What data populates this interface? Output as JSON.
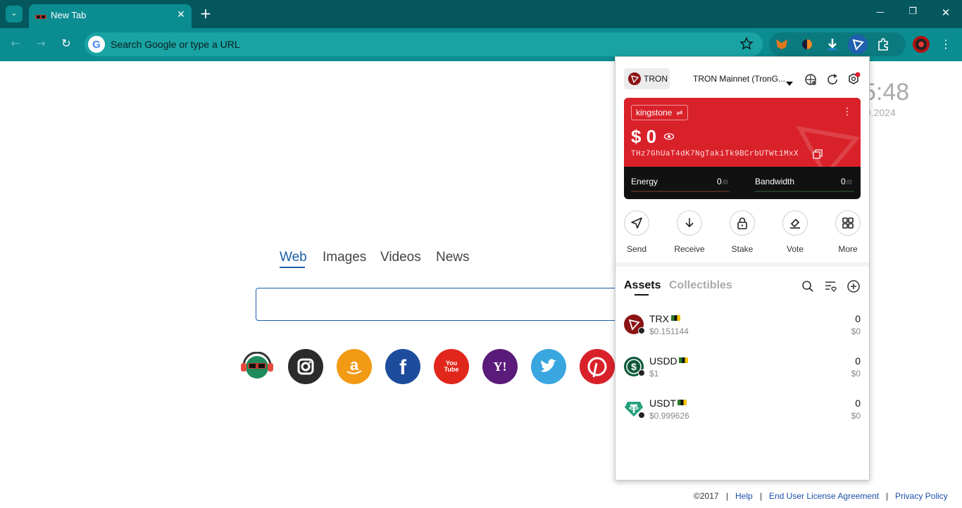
{
  "browser": {
    "tab_title": "New Tab",
    "omnibox_placeholder": "Search Google or type a URL",
    "tab_close_glyph": "✕",
    "new_tab_glyph": "+",
    "minimize_glyph": "—",
    "restore_glyph": "❐",
    "close_glyph": "✕"
  },
  "page": {
    "search_tabs": [
      "Web",
      "Images",
      "Videos",
      "News"
    ],
    "active_tab": "Web",
    "clock_time": "5:48",
    "clock_date": ".9.2024",
    "footer": {
      "copyright": "©2017",
      "sep": "|",
      "help": "Help",
      "eula": "End User License Agreement",
      "privacy": "Privacy Policy"
    },
    "social_icons": [
      {
        "name": "instagram",
        "color": "#2b2b2b"
      },
      {
        "name": "amazon",
        "color": "#f29a13"
      },
      {
        "name": "facebook",
        "color": "#1d4c9c"
      },
      {
        "name": "youtube",
        "color": "#e1261c"
      },
      {
        "name": "yahoo",
        "color": "#5b1b7a"
      },
      {
        "name": "twitter",
        "color": "#3aa6e0"
      },
      {
        "name": "pinterest",
        "color": "#d9212a"
      }
    ],
    "youtube_label": "You Tube",
    "yahoo_label": "Y!"
  },
  "wallet": {
    "network_chip": "TRON",
    "network_select": "TRON Mainnet (TronG...",
    "account": {
      "name": "kingstone",
      "switch_glyph": "⇌",
      "balance": "$ 0",
      "address": "THz7GhUaT4dK7NgTakiTk9BCrbUTWt1MxX"
    },
    "resources": {
      "energy_label": "Energy",
      "energy_value": "0",
      "energy_max": "/0",
      "bandwidth_label": "Bandwidth",
      "bandwidth_value": "0",
      "bandwidth_max": "/0"
    },
    "actions": [
      "Send",
      "Receive",
      "Stake",
      "Vote",
      "More"
    ],
    "tabs": {
      "assets": "Assets",
      "collectibles": "Collectibles"
    },
    "assets": [
      {
        "symbol": "TRX",
        "price": "$0.151144",
        "amount": "0",
        "usd": "$0",
        "color": "#8b1414"
      },
      {
        "symbol": "USDD",
        "price": "$1",
        "amount": "0",
        "usd": "$0",
        "color": "#0e5a3a"
      },
      {
        "symbol": "USDT",
        "price": "$0.999626",
        "amount": "0",
        "usd": "$0",
        "color": "#26a17b"
      }
    ],
    "colors": {
      "card_red": "#d9212a",
      "card_dark": "#111111"
    }
  }
}
